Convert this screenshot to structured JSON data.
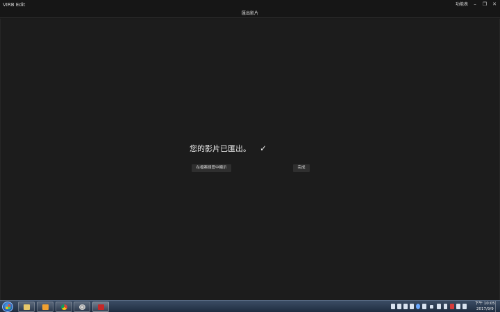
{
  "window": {
    "app_title": "VIRB Edit",
    "menu_label": "功能表",
    "minimize": "–",
    "restore": "❐",
    "close": "✕"
  },
  "header": {
    "title": "匯出影片"
  },
  "main": {
    "message": "您的影片已匯出。",
    "check_glyph": "✓",
    "open_in_explorer_label": "在檔案總管中顯示",
    "done_label": "完成"
  },
  "taskbar": {
    "items": [
      {
        "name": "file-explorer",
        "icon": "folder-icon"
      },
      {
        "name": "media-player",
        "icon": "media-icon"
      },
      {
        "name": "chrome",
        "icon": "chrome-icon"
      },
      {
        "name": "disc-app",
        "icon": "disc-icon"
      },
      {
        "name": "virb-edit",
        "icon": "garmin-icon",
        "active": true
      }
    ],
    "clock": {
      "time": "下午 10:05",
      "date": "2017/9/9"
    }
  }
}
